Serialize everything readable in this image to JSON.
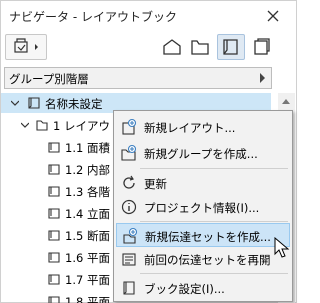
{
  "window": {
    "title": "ナビゲータ - レイアウトブック"
  },
  "toolbar": {
    "icons": [
      "layout-menu-icon",
      "house-icon",
      "folder-icon",
      "layout-book-icon",
      "publisher-icon"
    ],
    "active_index": 3
  },
  "group_select": {
    "label": "グループ別階層"
  },
  "tree": {
    "root": "名称未設定",
    "subset": "1 レイアウト",
    "items": [
      "1.1 面積",
      "1.2 内部",
      "1.3 各階",
      "1.4 立面",
      "1.5 断面",
      "1.6 平面",
      "1.7 平面",
      "1.8 平面"
    ]
  },
  "context_menu": {
    "items": [
      {
        "label": "新規レイアウト...",
        "icon": "new-layout-icon"
      },
      {
        "label": "新規グループを作成...",
        "icon": "new-group-icon"
      },
      {
        "label": "更新",
        "icon": "refresh-icon"
      },
      {
        "label": "プロジェクト情報(I)...",
        "icon": "info-icon"
      },
      {
        "label": "新規伝達セットを作成...",
        "icon": "new-publisher-set-icon"
      },
      {
        "label": "前回の伝達セットを再開",
        "icon": "resume-publisher-icon"
      },
      {
        "label": "ブック設定(I)...",
        "icon": "book-settings-icon"
      }
    ],
    "hovered_index": 4
  },
  "colors": {
    "selection": "#cde6f7",
    "menu_hover": "#cce4f7",
    "accent": "#3c7fc1"
  }
}
